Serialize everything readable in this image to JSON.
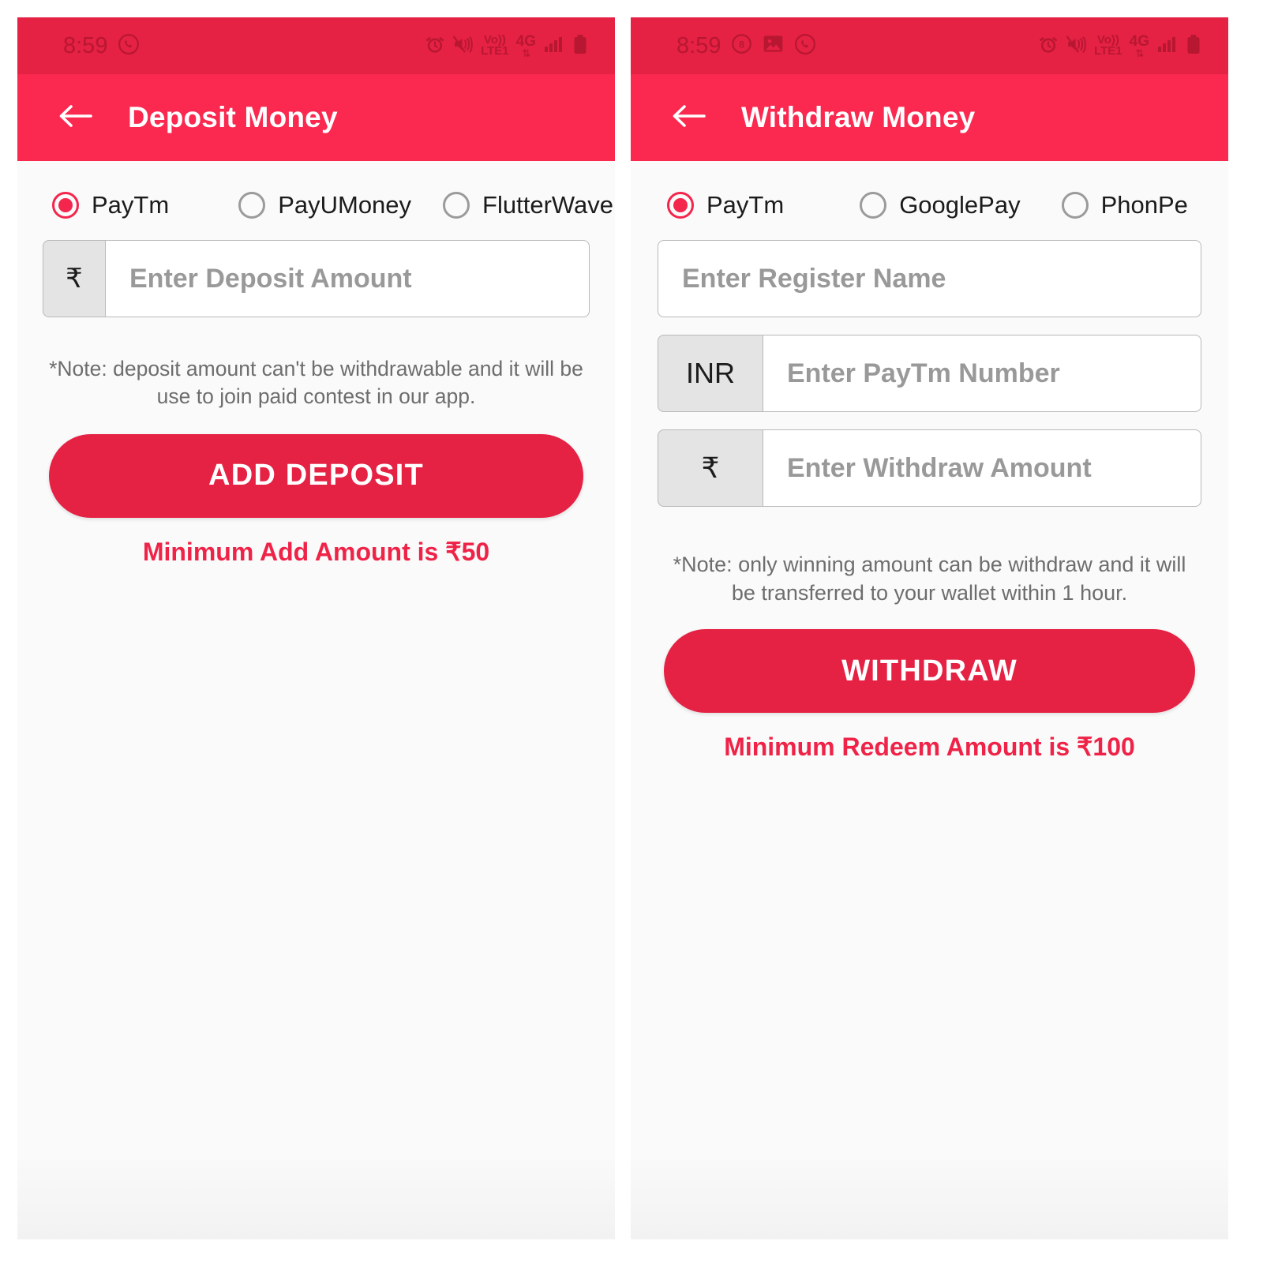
{
  "screens": [
    {
      "id": "deposit",
      "status_bar": {
        "time": "8:59",
        "left_icons": [
          "whatsapp-icon"
        ],
        "right_icons": [
          "alarm-icon",
          "mute-vibrate-icon",
          "volte-icon",
          "4g-icon",
          "signal-icon",
          "battery-icon"
        ],
        "volte_line1": "Vo))",
        "volte_line2": "LTE1",
        "network_label": "4G"
      },
      "appbar": {
        "back_icon": "arrow-left-icon",
        "title": "Deposit Money"
      },
      "payment_methods": {
        "selected": "PayTm",
        "options": [
          "PayTm",
          "PayUMoney",
          "FlutterWave"
        ]
      },
      "fields": [
        {
          "name": "deposit-amount",
          "prefix": "₹",
          "prefix_type": "symbol",
          "placeholder": "Enter Deposit Amount",
          "value": ""
        }
      ],
      "note": "*Note: deposit amount can't be withdrawable and it will be use to join paid contest in our app.",
      "primary_button": "ADD DEPOSIT",
      "minimum_text": "Minimum Add Amount is ₹50"
    },
    {
      "id": "withdraw",
      "status_bar": {
        "time": "8:59",
        "left_icons": [
          "notification-badge-icon",
          "photo-icon",
          "whatsapp-icon"
        ],
        "badge_count": "8",
        "right_icons": [
          "alarm-icon",
          "mute-vibrate-icon",
          "volte-icon",
          "4g-icon",
          "signal-icon",
          "battery-icon"
        ],
        "volte_line1": "Vo))",
        "volte_line2": "LTE1",
        "network_label": "4G"
      },
      "appbar": {
        "back_icon": "arrow-left-icon",
        "title": "Withdraw Money"
      },
      "payment_methods": {
        "selected": "PayTm",
        "options": [
          "PayTm",
          "GooglePay",
          "PhonPe"
        ]
      },
      "fields": [
        {
          "name": "register-name",
          "prefix": "",
          "prefix_type": "none",
          "placeholder": "Enter Register Name",
          "value": ""
        },
        {
          "name": "paytm-number",
          "prefix": "INR",
          "prefix_type": "currency-code",
          "placeholder": "Enter PayTm Number",
          "value": ""
        },
        {
          "name": "withdraw-amount",
          "prefix": "₹",
          "prefix_type": "symbol",
          "placeholder": "Enter Withdraw Amount",
          "value": ""
        }
      ],
      "note": "*Note: only winning amount can be withdraw and it will be transferred to your wallet within 1 hour.",
      "primary_button": "WITHDRAW",
      "minimum_text": "Minimum Redeem Amount is ₹100"
    }
  ],
  "colors": {
    "statusbar_red": "#e52144",
    "appbar_red": "#fb2850",
    "button_red": "#e52144",
    "accent_red": "#f4264d",
    "min_text_red": "#ef2348",
    "page_bg": "#fafafa",
    "field_border": "#b9b9b9",
    "prefix_bg": "#e4e4e4",
    "placeholder_gray": "#999999",
    "note_gray": "#6d6d6d"
  }
}
